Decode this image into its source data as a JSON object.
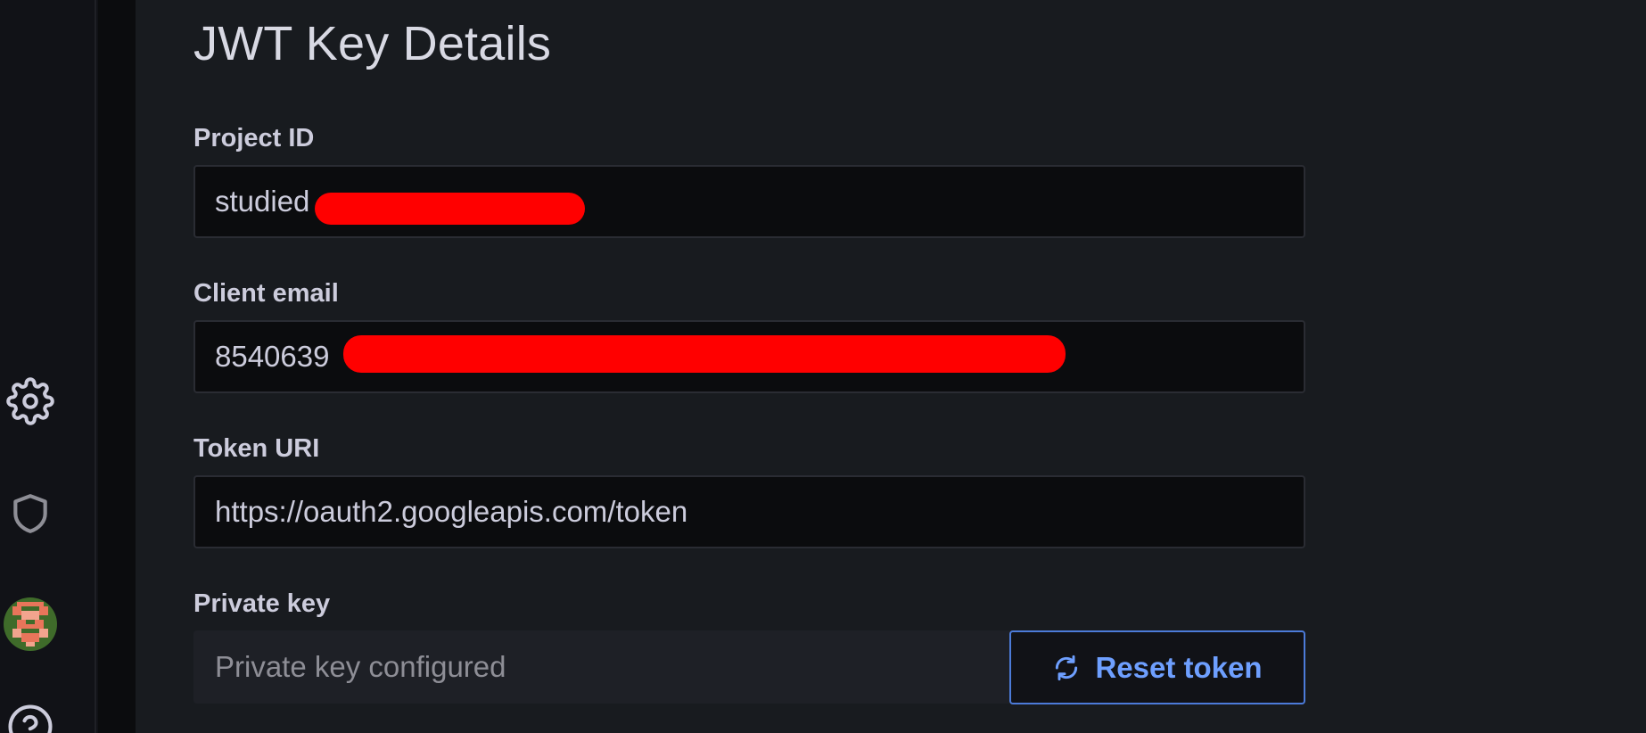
{
  "page": {
    "title": "JWT Key Details"
  },
  "fields": {
    "project_id": {
      "label": "Project ID",
      "value": "studied"
    },
    "client_email": {
      "label": "Client email",
      "value": "8540639"
    },
    "token_uri": {
      "label": "Token URI",
      "value": "https://oauth2.googleapis.com/token"
    },
    "private_key": {
      "label": "Private key",
      "placeholder": "Private key configured"
    }
  },
  "actions": {
    "reset_token_label": "Reset token"
  },
  "sidebar": {
    "icons": [
      "gear-icon",
      "shield-icon",
      "avatar",
      "help-icon"
    ]
  },
  "colors": {
    "accent": "#6e9fff",
    "redaction": "#ff0000",
    "background": "#181b1f"
  }
}
